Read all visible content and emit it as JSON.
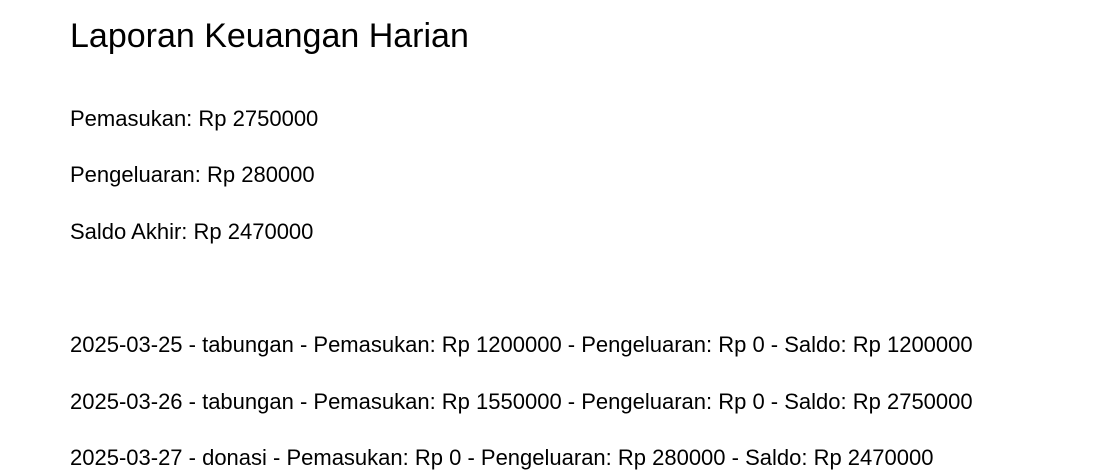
{
  "report": {
    "title": "Laporan Keuangan Harian",
    "summary": {
      "income": "Pemasukan: Rp 2750000",
      "expense": "Pengeluaran: Rp 280000",
      "balance": "Saldo Akhir: Rp 2470000"
    },
    "transactions": [
      "2025-03-25 - tabungan - Pemasukan: Rp 1200000 - Pengeluaran: Rp 0 - Saldo: Rp 1200000",
      "2025-03-26 - tabungan - Pemasukan: Rp 1550000 - Pengeluaran: Rp 0 - Saldo: Rp 2750000",
      "2025-03-27 - donasi - Pemasukan: Rp 0 - Pengeluaran: Rp 280000 - Saldo: Rp 2470000"
    ]
  }
}
